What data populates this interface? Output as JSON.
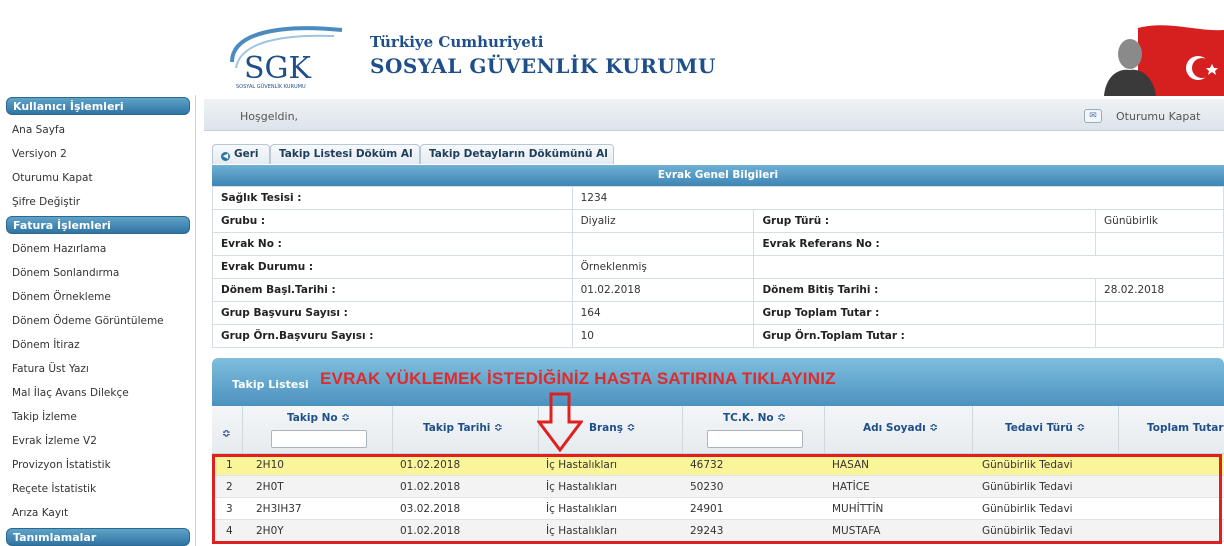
{
  "header": {
    "logo_text": "SGK",
    "logo_sub": "SOSYAL GÜVENLİK KURUMU",
    "title_line1": "Türkiye Cumhuriyeti",
    "title_line2": "SOSYAL GÜVENLİK KURUMU"
  },
  "sidebar": {
    "sections": [
      {
        "title": "Kullanıcı İşlemleri",
        "items": [
          "Ana Sayfa",
          "Versiyon 2",
          "Oturumu Kapat",
          "Şifre Değiştir"
        ]
      },
      {
        "title": "Fatura İşlemleri",
        "items": [
          "Dönem Hazırlama",
          "Dönem Sonlandırma",
          "Dönem Örnekleme",
          "Dönem Ödeme Görüntüleme",
          "Dönem İtiraz",
          "Fatura Üst Yazı",
          "Mal İlaç Avans Dilekçe",
          "Takip İzleme",
          "Evrak İzleme V2",
          "Provizyon İstatistik",
          "Reçete İstatistik",
          "Arıza Kayıt"
        ]
      },
      {
        "title": "Tanımlamalar",
        "items": []
      }
    ]
  },
  "topbar": {
    "welcome": "Hoşgeldin,",
    "logout": "Oturumu Kapat"
  },
  "tabs": {
    "back": "Geri",
    "print_list": "Takip Listesi Döküm Al",
    "print_details": "Takip Detayların Dökümünü Al"
  },
  "info": {
    "title": "Evrak Genel Bilgileri",
    "saglik_tesisi_label": "Sağlık Tesisi :",
    "saglik_tesisi_value": "1234",
    "grubu_label": "Grubu :",
    "grubu_value": "Diyaliz",
    "grup_turu_label": "Grup Türü :",
    "grup_turu_value": "Günübirlik",
    "evrak_no_label": "Evrak No :",
    "evrak_no_value": "",
    "evrak_ref_label": "Evrak Referans No :",
    "evrak_ref_value": "",
    "evrak_durumu_label": "Evrak Durumu :",
    "evrak_durumu_value": "Örneklenmiş",
    "donem_basl_label": "Dönem Başl.Tarihi :",
    "donem_basl_value": "01.02.2018",
    "donem_bitis_label": "Dönem Bitiş Tarihi :",
    "donem_bitis_value": "28.02.2018",
    "grup_basvuru_label": "Grup Başvuru Sayısı :",
    "grup_basvuru_value": "164",
    "grup_toplam_label": "Grup Toplam Tutar :",
    "grup_toplam_value": "",
    "grup_orn_basvuru_label": "Grup Örn.Başvuru Sayısı :",
    "grup_orn_basvuru_value": "10",
    "grup_orn_toplam_label": "Grup Örn.Toplam Tutar :",
    "grup_orn_toplam_value": ""
  },
  "list": {
    "title": "Takip Listesi",
    "instruction": "EVRAK YÜKLEMEK İSTEDİĞİNİZ HASTA SATIRINA TIKLAYINIZ",
    "columns": [
      "Takip No ≎",
      "Takip Tarihi ≎",
      "Branş ≎",
      "TC.K. No ≎",
      "Adı Soyadı ≎",
      "Tedavi Türü ≎",
      "Toplam Tutar"
    ],
    "sort_icon": "≎",
    "rows": [
      {
        "n": "1",
        "takip_no": "2H10",
        "tarih": "01.02.2018",
        "brans": "İç Hastalıkları",
        "tc": "46732",
        "ad": "HASAN",
        "tedavi": "Günübirlik Tedavi"
      },
      {
        "n": "2",
        "takip_no": "2H0T",
        "tarih": "01.02.2018",
        "brans": "İç Hastalıkları",
        "tc": "50230",
        "ad": "HATİCE",
        "tedavi": "Günübirlik Tedavi"
      },
      {
        "n": "3",
        "takip_no": "2H3IH37",
        "tarih": "03.02.2018",
        "brans": "İç Hastalıkları",
        "tc": "24901",
        "ad": "MUHİTTİN",
        "tedavi": "Günübirlik Tedavi"
      },
      {
        "n": "4",
        "takip_no": "2H0Y",
        "tarih": "01.02.2018",
        "brans": "İç Hastalıkları",
        "tc": "29243",
        "ad": "MUSTAFA",
        "tedavi": "Günübirlik Tedavi"
      }
    ]
  },
  "colors": {
    "accent": "#2f73a3",
    "instruction": "#e12b2b",
    "selected_row": "#fbf59a"
  }
}
